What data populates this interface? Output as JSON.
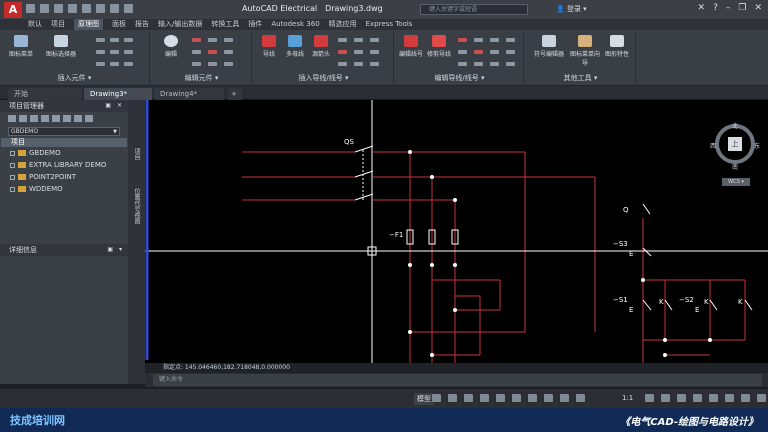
{
  "titlebar": {
    "app_title": "AutoCAD Electrical",
    "file": "Drawing3.dwg",
    "search_placeholder": "键入关键字或短语",
    "user": "登录",
    "logo": "A"
  },
  "menu": [
    "默认",
    "项目",
    "原理图",
    "面板",
    "报告",
    "输入/输出数据",
    "转换工具",
    "插件",
    "Autodesk 360",
    "精选应用",
    "Express Tools"
  ],
  "menu_active_index": 2,
  "ribbon": {
    "groups": [
      {
        "label": "插入元件 ▾"
      },
      {
        "label": "编辑元件 ▾"
      },
      {
        "label": "插入导线/线号 ▾"
      },
      {
        "label": "编辑导线/线号 ▾"
      },
      {
        "label": "其他工具 ▾"
      }
    ],
    "buttons": [
      "图标菜单",
      "图标选择器",
      "编辑",
      "导线",
      "多母线",
      "源箭头",
      "修剪导线",
      "符号编辑器",
      "图标菜单向导",
      "图形特性"
    ]
  },
  "tabs": [
    "开始",
    "Drawing3*",
    "Drawing4*"
  ],
  "tab_active_index": 1,
  "tab_add": "+",
  "project_manager": {
    "title": "项目管理器",
    "selected_project": "GBDEMO",
    "header": "项目",
    "projects": [
      "GBDEMO",
      "EXTRA LIBRARY DEMO",
      "POINT2POINT",
      "WDDEMO"
    ]
  },
  "details": {
    "title": "详细信息"
  },
  "side_tabs": [
    "项目",
    "位置代号视图"
  ],
  "compass": {
    "n": "北",
    "s": "南",
    "e": "东",
    "w": "西",
    "center": "上",
    "ucs": "WCS ▾"
  },
  "schematic_labels": {
    "qs": "QS",
    "f1": "−F1",
    "q": "Q",
    "s3": "−S3",
    "e3": "E",
    "s1": "−S1",
    "e1": "E",
    "k1": "K",
    "s2": "−S2",
    "e2": "E",
    "k2": "K",
    "k3": "K"
  },
  "command": {
    "history": "指定点: 145.046460,182.718048,0.000000",
    "placeholder": "键入命令"
  },
  "status": {
    "model": "模型",
    "scale": "1:1"
  },
  "footer": {
    "brand": "技成培训网",
    "course": "《电气CAD-绘图与电路设计》"
  }
}
